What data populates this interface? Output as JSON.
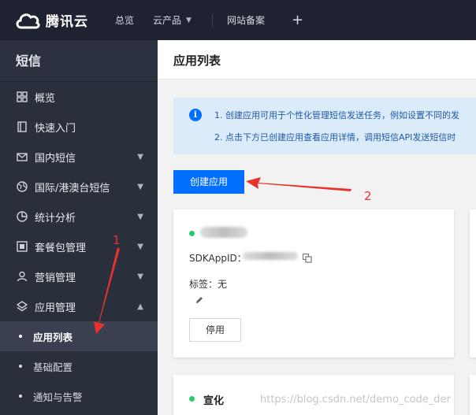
{
  "topbar": {
    "brand": "腾讯云",
    "nav": [
      "总览",
      "云产品",
      "网站备案"
    ],
    "plus": "+"
  },
  "sidebar": {
    "title": "短信",
    "items": [
      {
        "label": "概览",
        "icon": "grid-icon"
      },
      {
        "label": "快速入门",
        "icon": "book-icon"
      },
      {
        "label": "国内短信",
        "icon": "mail-icon",
        "expand": "⌄"
      },
      {
        "label": "国际/港澳台短信",
        "icon": "globe-icon",
        "expand": "⌄"
      },
      {
        "label": "统计分析",
        "icon": "pie-icon",
        "expand": "⌄"
      },
      {
        "label": "套餐包管理",
        "icon": "package-icon",
        "expand": "⌄"
      },
      {
        "label": "营销管理",
        "icon": "person-icon",
        "expand": "⌄"
      },
      {
        "label": "应用管理",
        "icon": "layers-icon",
        "expand": "⌃"
      }
    ],
    "sub_items": [
      {
        "label": "应用列表",
        "active": true
      },
      {
        "label": "基础配置",
        "active": false
      },
      {
        "label": "通知与告警",
        "active": false
      }
    ]
  },
  "main": {
    "title": "应用列表",
    "notice": {
      "icon": "i",
      "line1": "1. 创建应用可用于个性化管理短信发送任务，例如设置不同的发",
      "line2": "2. 点击下方已创建应用查看应用详情，调用短信API发送短信时"
    },
    "create_button": "创建应用",
    "app_cards": [
      {
        "sdk_label": "SDKAppID：",
        "tag_label": "标签：无",
        "disable_button": "停用"
      },
      {
        "name": "宣化"
      }
    ]
  },
  "annotations": {
    "label1": "1",
    "label2": "2"
  },
  "watermark": "https://blog.csdn.net/demo_code_der",
  "colors": {
    "topbar_bg": "#1f2331",
    "sidebar_bg": "#2a2f3c",
    "primary": "#006eff",
    "status_green": "#29cc6a",
    "annotation_red": "#e8322c",
    "notice_bg": "#dcebfa"
  }
}
